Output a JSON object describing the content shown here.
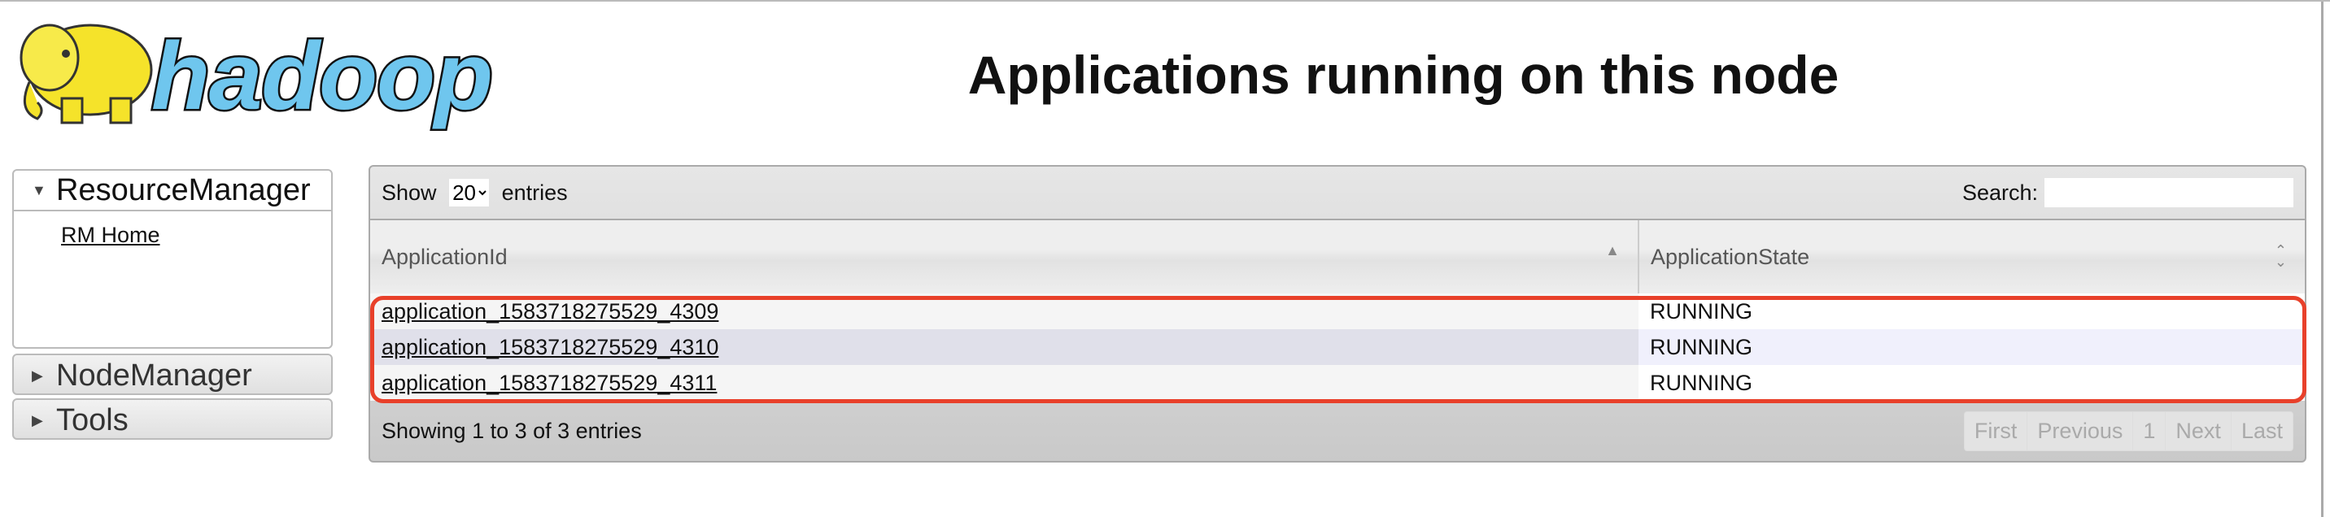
{
  "logo_text": "hadoop",
  "page_title": "Applications running on this node",
  "sidebar": {
    "sections": [
      {
        "label": "ResourceManager",
        "expanded": true,
        "links": [
          "RM Home"
        ]
      },
      {
        "label": "NodeManager",
        "expanded": false
      },
      {
        "label": "Tools",
        "expanded": false
      }
    ]
  },
  "table": {
    "show_label": "Show",
    "entries_label": "entries",
    "page_size": "20",
    "search_label": "Search:",
    "search_value": "",
    "columns": [
      "ApplicationId",
      "ApplicationState"
    ],
    "rows": [
      [
        "application_1583718275529_4309",
        "RUNNING"
      ],
      [
        "application_1583718275529_4310",
        "RUNNING"
      ],
      [
        "application_1583718275529_4311",
        "RUNNING"
      ]
    ],
    "info": "Showing 1 to 3 of 3 entries",
    "pager": [
      "First",
      "Previous",
      "1",
      "Next",
      "Last"
    ]
  },
  "colors": {
    "highlight": "#e8402a",
    "logo_blue": "#6fc6ee",
    "logo_yellow": "#f5e32a"
  }
}
